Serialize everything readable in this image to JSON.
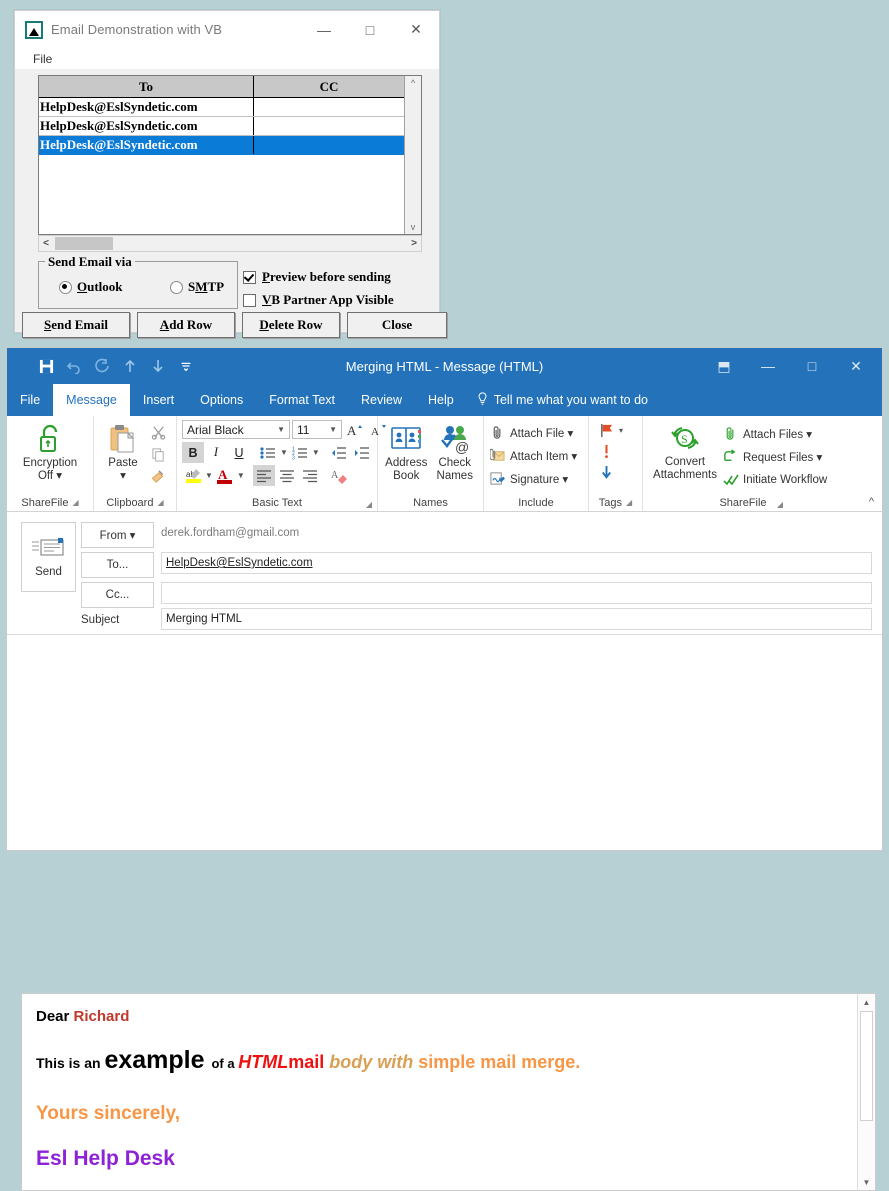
{
  "vb_window": {
    "title": "Email Demonstration with VB",
    "app_icon": "chart-triangle-icon",
    "controls": {
      "minimize": "—",
      "maximize": "□",
      "close": "✕"
    },
    "menu": [
      "File"
    ],
    "grid": {
      "columns": [
        "To",
        "CC"
      ],
      "rows": [
        {
          "to": "HelpDesk@EslSyndetic.com",
          "cc": "",
          "selected": false
        },
        {
          "to": "HelpDesk@EslSyndetic.com",
          "cc": "",
          "selected": false
        },
        {
          "to": "HelpDesk@EslSyndetic.com",
          "cc": "",
          "selected": true
        }
      ]
    },
    "group_box": {
      "legend": "Send Email via"
    },
    "radios": [
      {
        "label_pre": "",
        "accel": "O",
        "label_post": "utlook",
        "checked": true
      },
      {
        "label_pre": "S",
        "accel": "M",
        "label_post": "TP",
        "checked": false
      }
    ],
    "checkboxes": [
      {
        "accel": "P",
        "label_post": "review before sending",
        "checked": true
      },
      {
        "accel": "V",
        "label_post": "B Partner App Visible",
        "checked": false
      }
    ],
    "buttons": [
      {
        "accel": "S",
        "label_post": "end Email"
      },
      {
        "accel": "A",
        "label_post": "dd Row"
      },
      {
        "accel": "D",
        "label_post": "elete Row"
      },
      {
        "accel": "",
        "label_post": "Close"
      }
    ]
  },
  "outlook": {
    "title": "Merging HTML  -  Message (HTML)",
    "quick_access": [
      {
        "name": "save-icon",
        "glyph": "💾"
      },
      {
        "name": "undo-icon",
        "glyph": "↶"
      },
      {
        "name": "redo-icon",
        "glyph": "↻"
      },
      {
        "name": "move-up-icon",
        "glyph": "↑"
      },
      {
        "name": "move-down-icon",
        "glyph": "↓"
      },
      {
        "name": "customize-qat-icon",
        "glyph": "⌵"
      }
    ],
    "window_controls": {
      "ribbon_display": "⬒",
      "minimize": "—",
      "maximize": "□",
      "close": "✕"
    },
    "tabs": [
      {
        "label": "File",
        "active": false
      },
      {
        "label": "Message",
        "active": true
      },
      {
        "label": "Insert",
        "active": false
      },
      {
        "label": "Options",
        "active": false
      },
      {
        "label": "Format Text",
        "active": false
      },
      {
        "label": "Review",
        "active": false
      },
      {
        "label": "Help",
        "active": false
      }
    ],
    "tell_me": {
      "icon": "lightbulb-icon",
      "label": "Tell me what you want to do"
    },
    "ribbon": {
      "collapse_icon": "chevron-up-icon",
      "groups": [
        {
          "name": "sharefile-left",
          "label": "ShareFile",
          "has_launcher": true,
          "big_button": {
            "label_line1": "Encryption",
            "label_line2": "Off ▾",
            "icon": "unlocked-padlock-icon"
          }
        },
        {
          "name": "clipboard",
          "label": "Clipboard",
          "has_launcher": true,
          "big_button": {
            "label_line1": "Paste",
            "label_line2": "▾",
            "icon": "clipboard-icon"
          },
          "small_buttons": [
            {
              "label": "",
              "icon": "cut-scissors-icon"
            },
            {
              "label": "",
              "icon": "copy-icon"
            },
            {
              "label": "",
              "icon": "format-painter-icon"
            }
          ]
        },
        {
          "name": "basic-text",
          "label": "Basic Text",
          "has_launcher": true,
          "font_name": "Arial Black",
          "font_size": "11",
          "buttons": [
            {
              "label": "B",
              "name": "bold-button",
              "active": true
            },
            {
              "label": "I",
              "name": "italic-button",
              "active": false
            },
            {
              "label": "U",
              "name": "underline-button",
              "active": false
            },
            {
              "label": "",
              "name": "bullets-icon",
              "active": false
            },
            {
              "label": "",
              "name": "numbering-icon",
              "active": false
            },
            {
              "label": "",
              "name": "decrease-indent-icon",
              "active": false
            },
            {
              "label": "",
              "name": "increase-indent-icon",
              "active": false
            },
            {
              "label": "",
              "name": "text-highlight-color-icon",
              "active": false
            },
            {
              "label": "",
              "name": "font-color-icon",
              "active": false
            },
            {
              "label": "",
              "name": "align-left-icon",
              "active": true
            },
            {
              "label": "",
              "name": "align-center-icon",
              "active": false
            },
            {
              "label": "",
              "name": "align-right-icon",
              "active": false
            },
            {
              "label": "",
              "name": "clear-formatting-icon",
              "active": false
            },
            {
              "label": "",
              "name": "grow-font-icon",
              "active": false
            },
            {
              "label": "",
              "name": "shrink-font-icon",
              "active": false
            }
          ]
        },
        {
          "name": "names",
          "label": "Names",
          "has_launcher": false,
          "big_buttons": [
            {
              "label_line1": "Address",
              "label_line2": "Book",
              "icon": "address-book-icon"
            },
            {
              "label_line1": "Check",
              "label_line2": "Names",
              "icon": "check-names-icon"
            }
          ]
        },
        {
          "name": "include",
          "label": "Include",
          "has_launcher": false,
          "items": [
            {
              "label": "Attach File ▾",
              "icon": "paperclip-icon"
            },
            {
              "label": "Attach Item ▾",
              "icon": "attach-item-icon"
            },
            {
              "label": "Signature ▾",
              "icon": "signature-icon"
            }
          ]
        },
        {
          "name": "tags",
          "label": "Tags",
          "has_launcher": true,
          "items": [
            {
              "label": "▾",
              "icon": "follow-up-flag-icon"
            },
            {
              "label": "",
              "icon": "high-importance-icon"
            },
            {
              "label": "",
              "icon": "low-importance-icon"
            }
          ]
        },
        {
          "name": "sharefile",
          "label": "ShareFile",
          "has_launcher": true,
          "big_button": {
            "label_line1": "Convert",
            "label_line2": "Attachments",
            "icon": "convert-attachments-icon"
          },
          "items": [
            {
              "label": "Attach Files ▾",
              "icon": "paperclip-green-icon"
            },
            {
              "label": "Request Files  ▾",
              "icon": "request-files-icon"
            },
            {
              "label": "Initiate Workflow",
              "icon": "initiate-workflow-icon"
            }
          ]
        }
      ]
    },
    "header": {
      "send_button": {
        "label": "Send",
        "icon": "send-envelope-icon"
      },
      "from": {
        "button_label": "From ▾",
        "value": "derek.fordham@gmail.com"
      },
      "to": {
        "button_label": "To...",
        "value": "HelpDesk@EslSyndetic.com"
      },
      "cc": {
        "button_label": "Cc...",
        "value": ""
      },
      "subject": {
        "label": "Subject",
        "value": "Merging HTML"
      }
    },
    "body": {
      "scroll": {
        "up": "▲",
        "down": "▼"
      },
      "lines": [
        {
          "name": "salutation-line",
          "segments": [
            {
              "text": "Dear ",
              "color": "#000000",
              "bold": true,
              "italic": false,
              "size": 15,
              "family": "sans"
            },
            {
              "text": "Richard",
              "color": "#c0392b",
              "bold": true,
              "italic": false,
              "size": 15,
              "family": "sans"
            }
          ]
        },
        {
          "name": "body-line",
          "segments": [
            {
              "text": "This is an ",
              "color": "#000000",
              "bold": true,
              "italic": false,
              "size": 14,
              "family": "sans"
            },
            {
              "text": "example ",
              "color": "#000000",
              "bold": true,
              "italic": false,
              "size": 25,
              "family": "sans"
            },
            {
              "text": "of a ",
              "color": "#000000",
              "bold": true,
              "italic": false,
              "size": 13,
              "family": "sans"
            },
            {
              "text": "HTML",
              "color": "#ee1111",
              "bold": true,
              "italic": true,
              "size": 18,
              "family": "sans"
            },
            {
              "text": "mail ",
              "color": "#ee1111",
              "bold": true,
              "italic": false,
              "size": 18,
              "family": "sans"
            },
            {
              "text": "body with ",
              "color": "#d9a055",
              "bold": true,
              "italic": true,
              "size": 18,
              "family": "sans"
            },
            {
              "text": "simple mail merge.",
              "color": "#f79646",
              "bold": true,
              "italic": false,
              "size": 18,
              "family": "sans"
            }
          ]
        },
        {
          "name": "closing-line",
          "segments": [
            {
              "text": "Yours sincerely,",
              "color": "#f79646",
              "bold": true,
              "italic": false,
              "size": 19,
              "family": "sans"
            }
          ]
        },
        {
          "name": "signature-line",
          "segments": [
            {
              "text": "Esl Help Desk",
              "color": "#8e22d6",
              "bold": true,
              "italic": false,
              "size": 21,
              "family": "sans"
            }
          ]
        }
      ]
    }
  }
}
